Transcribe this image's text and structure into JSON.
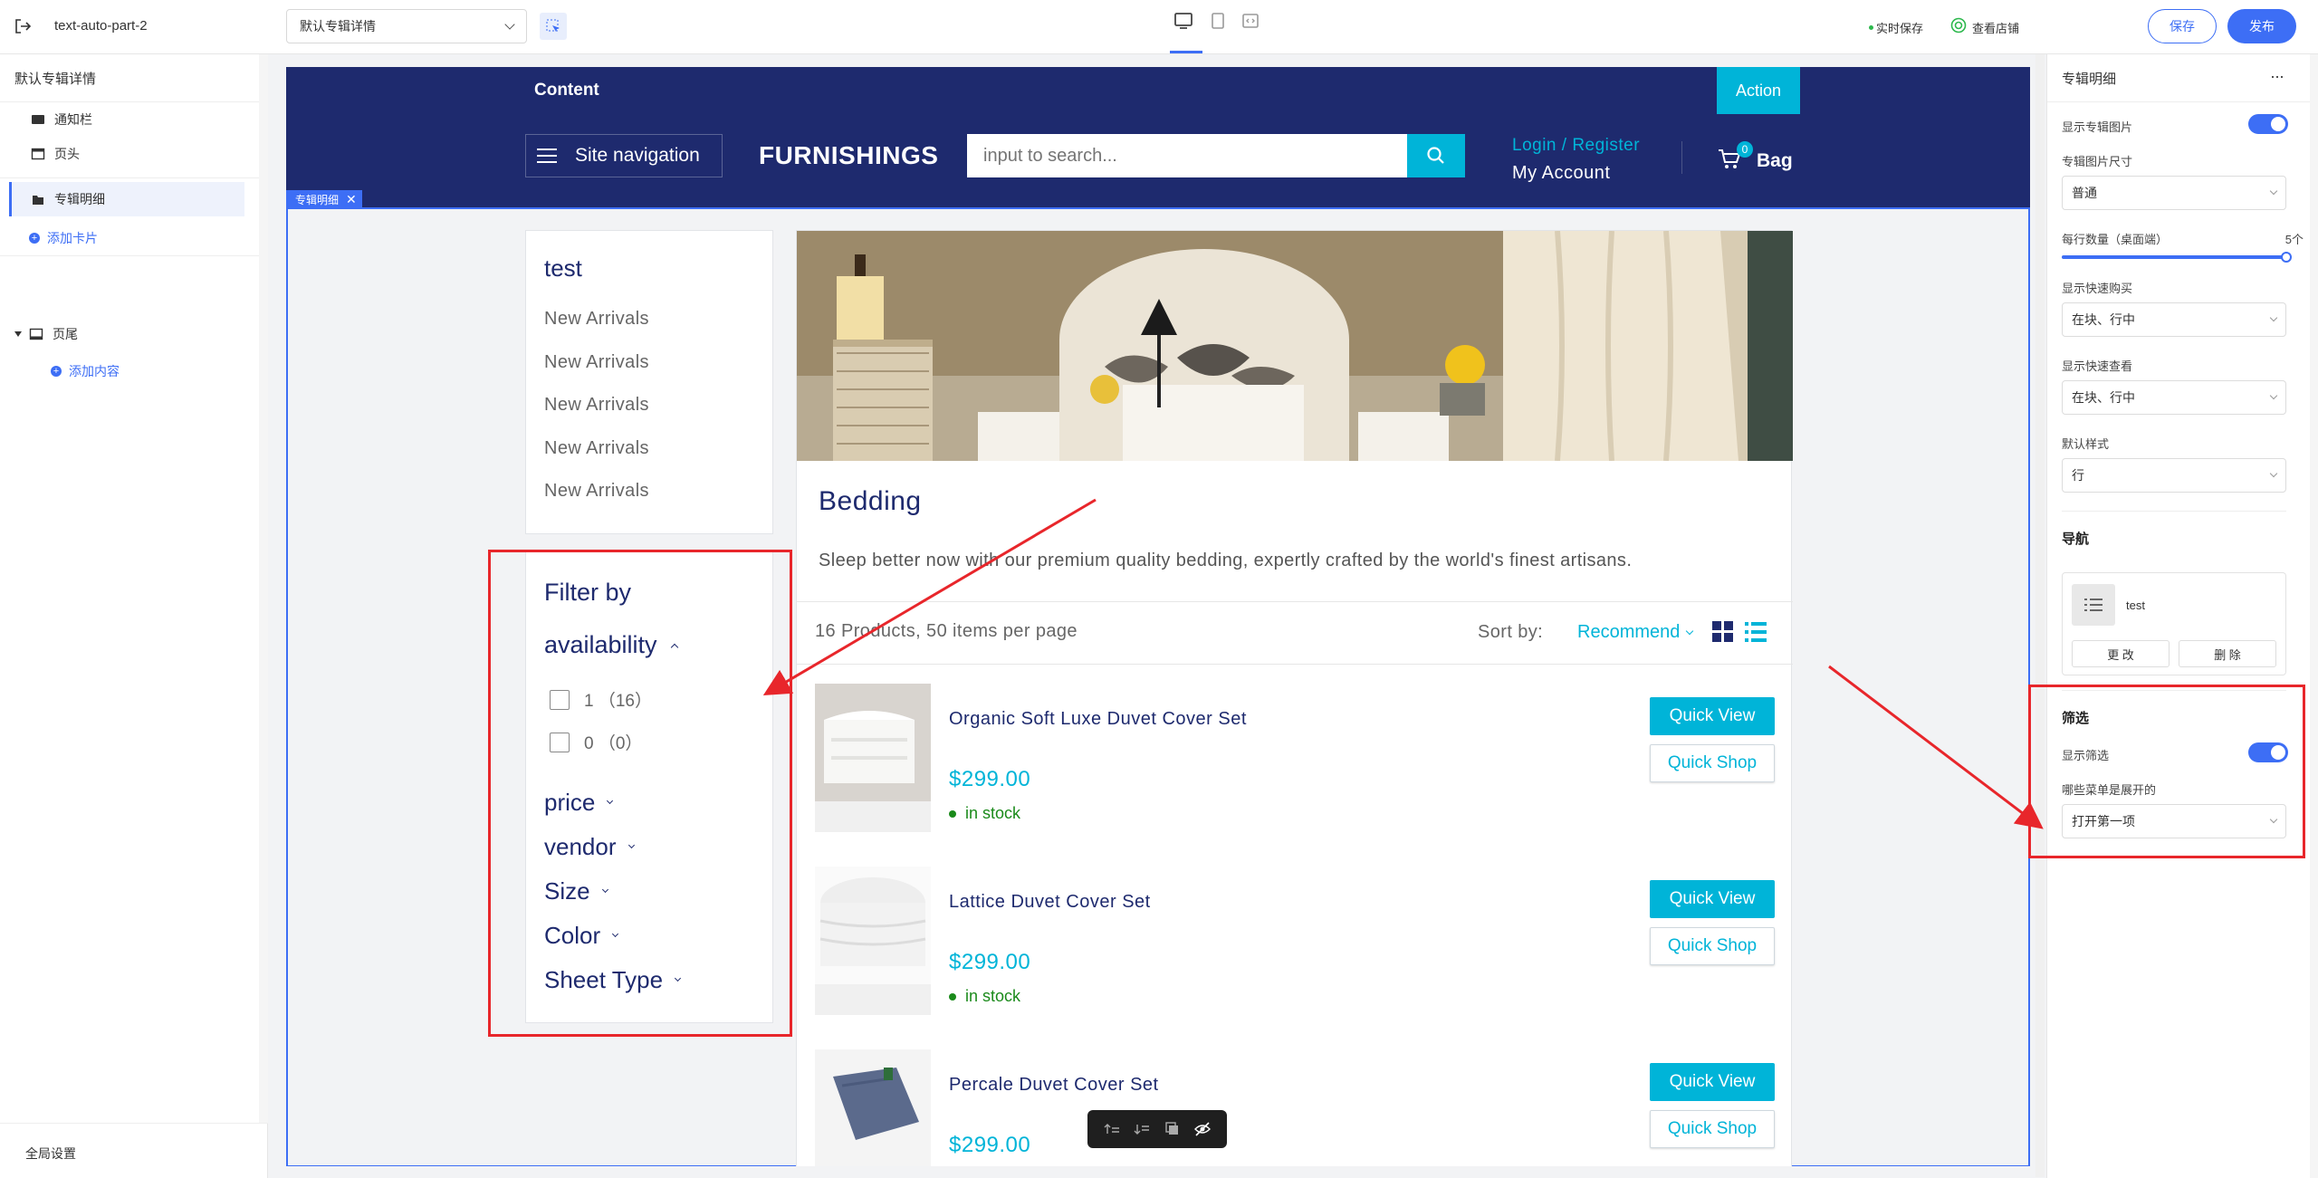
{
  "toolbar": {
    "project_name": "text-auto-part-2",
    "template_select": "默认专辑详情",
    "realtime_save": "实时保存",
    "view_store": "查看店铺",
    "save_label": "保存",
    "publish_label": "发布"
  },
  "left_panel": {
    "title": "默认专辑详情",
    "items": [
      {
        "label": "通知栏"
      },
      {
        "label": "页头"
      },
      {
        "label": "专辑明细"
      }
    ],
    "add_card": "添加卡片",
    "footer_group": "页尾",
    "add_content": "添加内容",
    "global_settings": "全局设置"
  },
  "store": {
    "announcement": "Content",
    "action_label": "Action",
    "site_nav": "Site navigation",
    "brand": "FURNISHINGS",
    "search_placeholder": "input to search...",
    "login_register": "Login / Register",
    "my_account": "My Account",
    "cart_count": "0",
    "bag_label": "Bag",
    "section_tag": "专辑明细",
    "sidebar_title": "test",
    "sidebar_links": [
      "New Arrivals",
      "New Arrivals",
      "New Arrivals",
      "New Arrivals",
      "New Arrivals"
    ],
    "filter_title_1": "Filter by",
    "filter_title_2": "availability",
    "availability_options": [
      {
        "label": "1 （16）",
        "checked": false
      },
      {
        "label": "0 （0）",
        "checked": false
      }
    ],
    "filters": [
      "price",
      "vendor",
      "Size",
      "Color",
      "Sheet Type"
    ],
    "collection_title": "Bedding",
    "collection_desc": "Sleep better now with our premium quality bedding, expertly crafted by the world's finest artisans.",
    "product_count": "16 Products, 50 items per page",
    "sort_label": "Sort by:",
    "sort_value": "Recommend",
    "products": [
      {
        "name": "Organic Soft Luxe Duvet Cover Set",
        "price": "$299.00",
        "stock": "in stock"
      },
      {
        "name": "Lattice Duvet Cover Set",
        "price": "$299.00",
        "stock": "in stock"
      },
      {
        "name": "Percale Duvet Cover Set",
        "price": "$299.00",
        "stock": ""
      }
    ],
    "quick_view": "Quick View",
    "quick_shop": "Quick Shop"
  },
  "right_panel": {
    "title": "专辑明细",
    "show_image": "显示专辑图片",
    "image_size": "专辑图片尺寸",
    "image_size_value": "普通",
    "per_row": "每行数量（桌面端）",
    "per_row_value": "5个",
    "per_row_level": 1.0,
    "quick_buy": "显示快速购买",
    "quick_buy_value": "在块、行中",
    "quick_view": "显示快速查看",
    "quick_view_value": "在块、行中",
    "default_style": "默认样式",
    "default_style_value": "行",
    "nav_heading": "导航",
    "nav_item": "test",
    "nav_edit": "更 改",
    "nav_delete": "删 除",
    "filter_heading": "筛选",
    "show_filter": "显示筛选",
    "expanded_menus": "哪些菜单是展开的",
    "expanded_value": "打开第一项"
  },
  "colors": {
    "accent": "#3d6ef5",
    "store_navy": "#1e2a6e",
    "cyan": "#00b4d8",
    "annotation_red": "#e8262b"
  }
}
